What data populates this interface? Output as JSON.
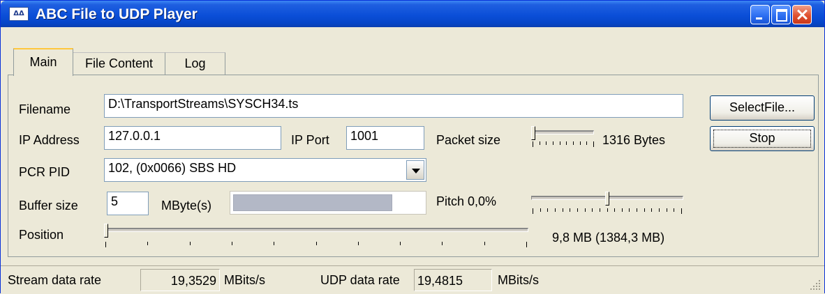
{
  "window": {
    "title": "ABC File to UDP Player",
    "icon": "app-logo-icon",
    "icon_text": "ΔΔ"
  },
  "tabs": [
    {
      "label": "Main",
      "selected": true
    },
    {
      "label": "File Content",
      "selected": false
    },
    {
      "label": "Log",
      "selected": false
    }
  ],
  "main": {
    "filename_label": "Filename",
    "filename_value": "D:\\TransportStreams\\SYSCH34.ts",
    "select_file_label": "SelectFile...",
    "ip_address_label": "IP Address",
    "ip_address_value": "127.0.0.1",
    "ip_port_label": "IP Port",
    "ip_port_value": "1001",
    "packet_size_label": "Packet size",
    "packet_size_value": "1316 Bytes",
    "packet_size_slider_fraction": 0.0,
    "stop_label": "Stop",
    "pcr_pid_label": "PCR PID",
    "pcr_pid_value": "102, (0x0066) SBS HD",
    "buffer_size_label": "Buffer size",
    "buffer_size_value": "5",
    "buffer_unit": "MByte(s)",
    "buffer_fill_fraction": 0.84,
    "pitch_label": "Pitch 0,0%",
    "pitch_slider_fraction": 0.5,
    "position_label": "Position",
    "position_slider_fraction": 0.0,
    "position_value": "9,8 MB (1384,3 MB)"
  },
  "statusbar": {
    "stream_rate_label": "Stream data rate",
    "stream_rate_value": "19,3529",
    "stream_rate_unit": "MBits/s",
    "udp_rate_label": "UDP data rate",
    "udp_rate_value": "19,4815",
    "udp_rate_unit": "MBits/s"
  }
}
